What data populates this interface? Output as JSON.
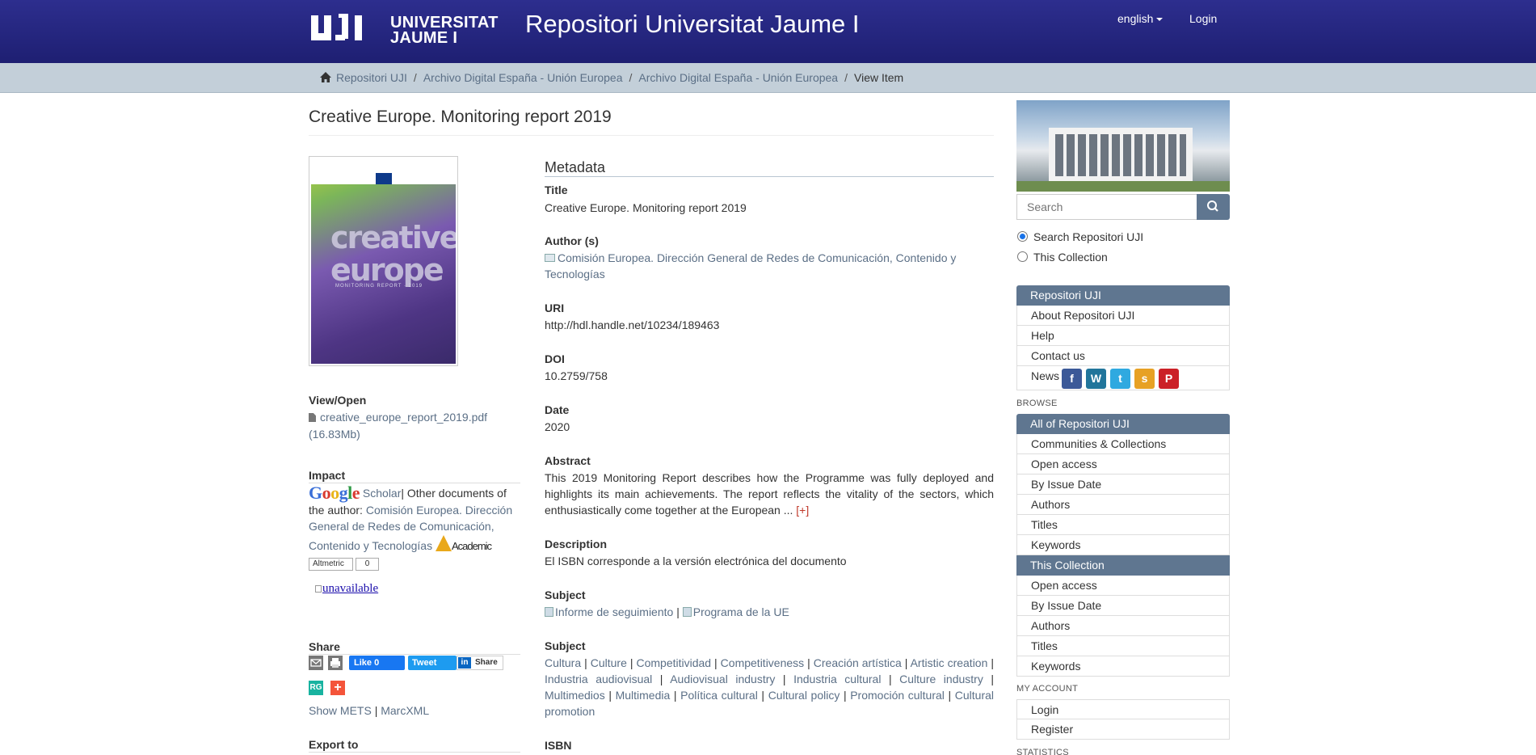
{
  "header": {
    "logo_text_1": "UNIVERSITAT",
    "logo_text_2": "JAUME I",
    "logo_mark": "UJI",
    "site_title": "Repositori Universitat Jaume I",
    "language": "english",
    "login": "Login"
  },
  "breadcrumb": [
    "Repositori UJI",
    "Archivo Digital España - Unión Europea",
    "Archivo Digital España - Unión Europea",
    "View Item"
  ],
  "item": {
    "title": "Creative Europe. Monitoring report 2019",
    "thumbnail_text": "creative europe",
    "thumbnail_subtext": "MONITORING REPORT · 2019"
  },
  "left": {
    "view_open_heading": "View/Open",
    "file_name": "creative_europe_report_2019.pdf",
    "file_size": "(16.83Mb)",
    "impact_heading": "Impact",
    "google_scholar": "Scholar",
    "other_docs": "| Other documents of the author: ",
    "author_link": "Comisión Europea. Dirección General de Redes de Comunicación, Contenido y Tecnologías",
    "academic_search": "Academic",
    "altmetric": "Altmetric",
    "altmetric_count": "0",
    "unavailable": "unavailable",
    "share_heading": "Share",
    "facebook": "Like 0",
    "tweet": "Tweet",
    "linkedin": "Share",
    "researchgate": "RG",
    "plus": "+",
    "show_mets": "Show METS",
    "mets_sep": " | ",
    "marcxml": "MarcXML",
    "export_heading": "Export to"
  },
  "metadata": {
    "heading": "Metadata",
    "title_label": "Title",
    "title_value": "Creative Europe. Monitoring report 2019",
    "author_label": "Author (s)",
    "author_value": "Comisión Europea. Dirección General de Redes de Comunicación, Contenido y Tecnologías",
    "uri_label": "URI",
    "uri_value": "http://hdl.handle.net/10234/189463",
    "doi_label": "DOI",
    "doi_value": "10.2759/758",
    "date_label": "Date",
    "date_value": "2020",
    "abstract_label": "Abstract",
    "abstract_value": "This 2019 Monitoring Report describes how the Programme was fully deployed and highlights its main achievements. The report reflects the vitality of the sectors, which enthusiastically come together at the European ...",
    "abstract_more": "[+]",
    "description_label": "Description",
    "description_value": "El ISBN corresponde a la versión electrónica del documento",
    "subject1_label": "Subject",
    "subject1_a": "Informe de seguimiento",
    "subject1_sep": " | ",
    "subject1_b": "Programa de la UE",
    "subject2_label": "Subject",
    "subject2_terms": [
      "Cultura",
      "Culture",
      "Competitividad",
      "Competitiveness",
      "Creación artística",
      "Artistic creation",
      "Industria audiovisual",
      "Audiovisual industry",
      "Industria cultural",
      "Culture industry",
      "Multimedios",
      "Multimedia",
      "Política cultural",
      "Cultural policy",
      "Promoción cultural",
      "Cultural promotion"
    ],
    "isbn_label": "ISBN"
  },
  "sidebar": {
    "search_placeholder": "Search",
    "scope_all": "Search Repositori UJI",
    "scope_collection": "This Collection",
    "repo_head": "Repositori UJI",
    "repo_items": [
      "About Repositori UJI",
      "Help",
      "Contact us",
      "News"
    ],
    "browse_label": "BROWSE",
    "all_head": "All of Repositori UJI",
    "all_items": [
      "Communities & Collections",
      "Open access",
      "By Issue Date",
      "Authors",
      "Titles",
      "Keywords"
    ],
    "coll_head": "This Collection",
    "coll_items": [
      "Open access",
      "By Issue Date",
      "Authors",
      "Titles",
      "Keywords"
    ],
    "account_label": "MY ACCOUNT",
    "account_items": [
      "Login",
      "Register"
    ],
    "statistics_label": "STATISTICS"
  },
  "icons": {
    "home": "home-icon",
    "search": "search-icon",
    "file": "file-icon",
    "social": [
      "facebook-icon",
      "wordpress-icon",
      "twitter-icon",
      "slideshare-icon",
      "pinterest-icon"
    ]
  },
  "colors": {
    "header": "#1e1f72",
    "breadcrumb_bar": "#c3cfd9",
    "nav_head": "#5f7690",
    "link": "#5b6f86"
  }
}
